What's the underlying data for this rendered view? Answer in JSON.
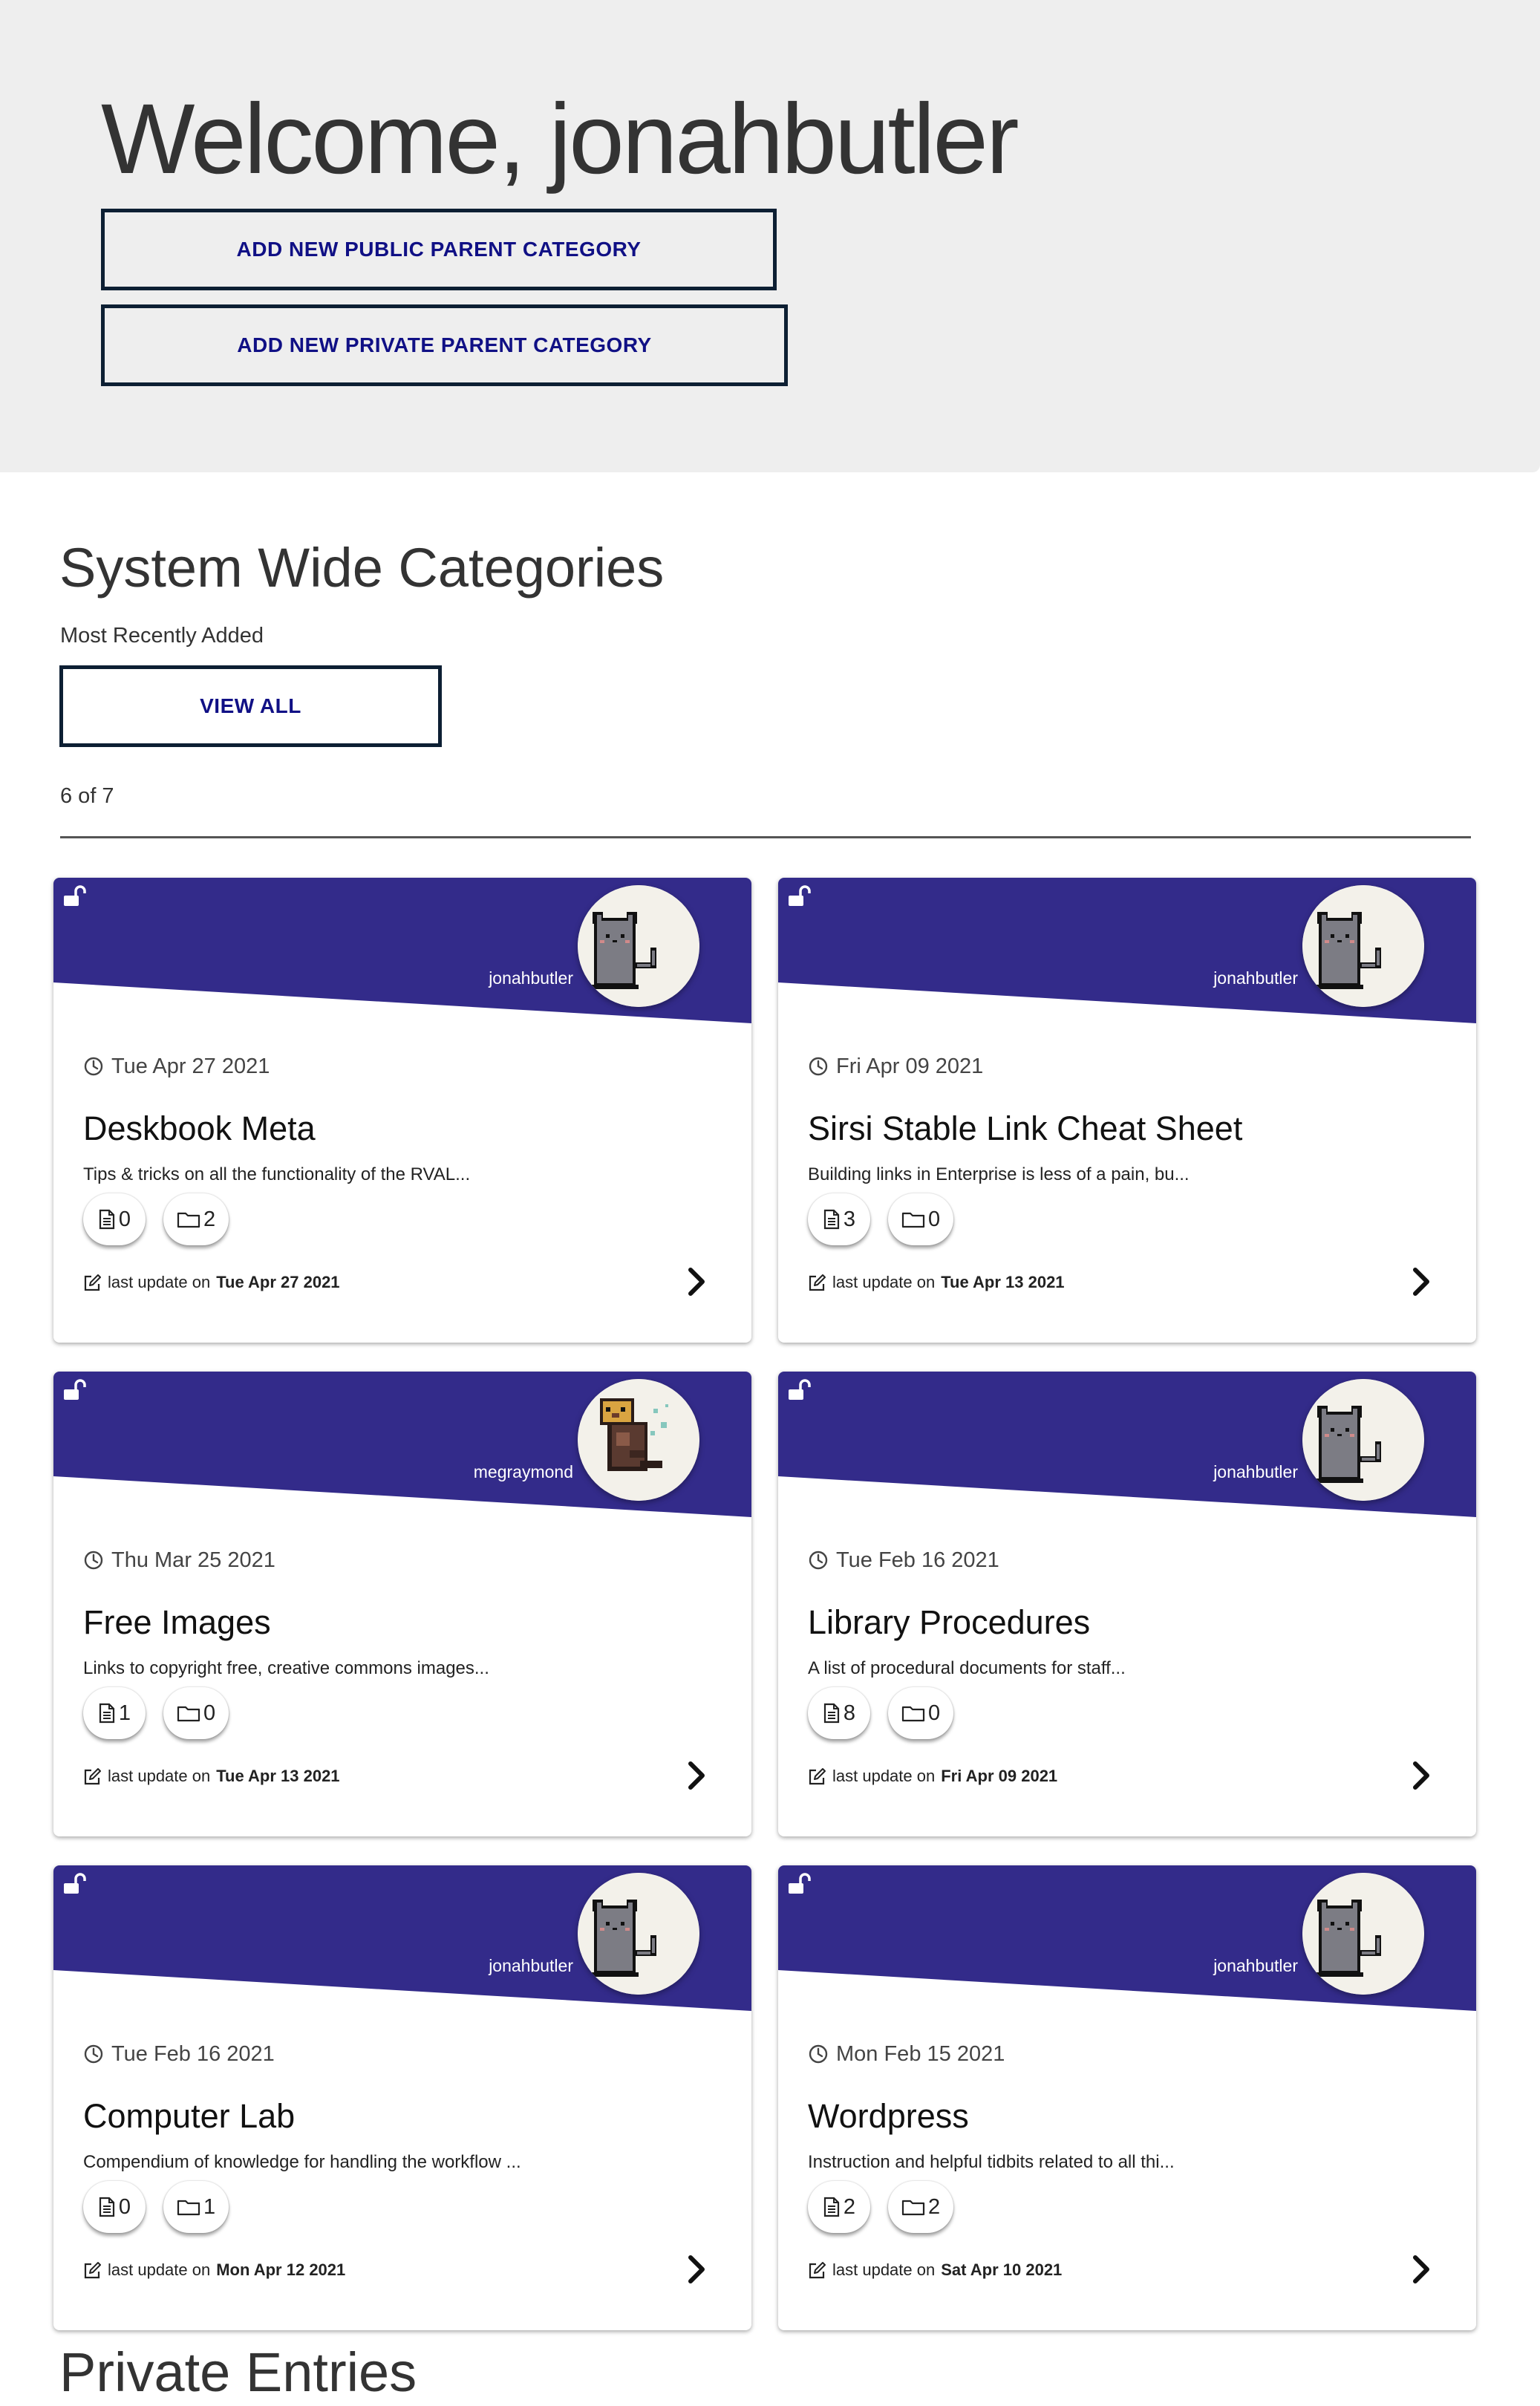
{
  "hero": {
    "title": "Welcome, jonahbutler",
    "add_public_label": "ADD NEW PUBLIC PARENT CATEGORY",
    "add_private_label": "ADD NEW PRIVATE PARENT CATEGORY"
  },
  "system_wide": {
    "title": "System Wide Categories",
    "subtitle": "Most Recently Added",
    "view_all_label": "VIEW ALL",
    "count_text": "6 of 7"
  },
  "colors": {
    "header_band": "#332b8a",
    "button_text": "#101085",
    "button_border": "#0d1f33"
  },
  "last_update_prefix": "last update on",
  "cards": [
    {
      "author": "jonahbutler",
      "avatar": "gray-cat",
      "date": "Tue Apr 27 2021",
      "title": "Deskbook Meta",
      "description": "Tips & tricks on all the functionality of the RVAL...",
      "docs": "0",
      "folders": "2",
      "last_update": "Tue Apr 27 2021"
    },
    {
      "author": "jonahbutler",
      "avatar": "gray-cat",
      "date": "Fri Apr 09 2021",
      "title": "Sirsi Stable Link Cheat Sheet",
      "description": "Building links in Enterprise is less of a pain, bu...",
      "docs": "3",
      "folders": "0",
      "last_update": "Tue Apr 13 2021"
    },
    {
      "author": "megraymond",
      "avatar": "otter",
      "date": "Thu Mar 25 2021",
      "title": "Free Images",
      "description": "Links to copyright free, creative commons images...",
      "docs": "1",
      "folders": "0",
      "last_update": "Tue Apr 13 2021"
    },
    {
      "author": "jonahbutler",
      "avatar": "gray-cat",
      "date": "Tue Feb 16 2021",
      "title": "Library Procedures",
      "description": "A list of procedural documents for staff...",
      "docs": "8",
      "folders": "0",
      "last_update": "Fri Apr 09 2021"
    },
    {
      "author": "jonahbutler",
      "avatar": "gray-cat",
      "date": "Tue Feb 16 2021",
      "title": "Computer Lab",
      "description": "Compendium of knowledge for handling the workflow ...",
      "docs": "0",
      "folders": "1",
      "last_update": "Mon Apr 12 2021"
    },
    {
      "author": "jonahbutler",
      "avatar": "gray-cat",
      "date": "Mon Feb 15 2021",
      "title": "Wordpress",
      "description": "Instruction and helpful tidbits related to all thi...",
      "docs": "2",
      "folders": "2",
      "last_update": "Sat Apr 10 2021"
    }
  ],
  "private_entries": {
    "title": "Private Entries"
  }
}
